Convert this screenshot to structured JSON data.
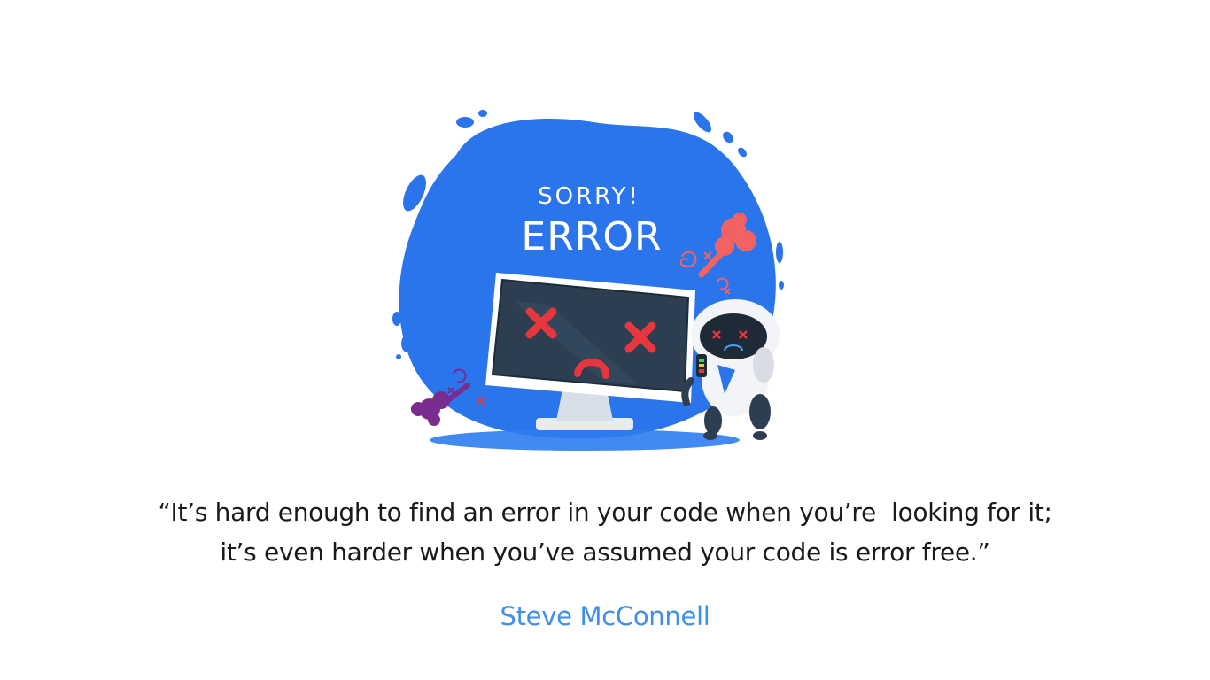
{
  "illustration": {
    "sorry_text": "SORRY!",
    "error_text": "ERROR"
  },
  "quote": {
    "line1": "“It’s hard enough to find an error in your code when you’re  looking for it;",
    "line2": "it’s even harder when you’ve assumed your code is error free.”"
  },
  "author": {
    "name": "Steve McConnell"
  },
  "colors": {
    "blob_blue": "#2a74ec",
    "accent_blue": "#3d8cf0",
    "author_blue": "#3f8ef0",
    "error_red": "#e8363e",
    "puff_pink": "#f26262",
    "puff_purple": "#7a2d8e",
    "quote_text": "#1a1a1a"
  },
  "icons": [
    "error-monitor-icon",
    "robot-mascot-icon"
  ]
}
